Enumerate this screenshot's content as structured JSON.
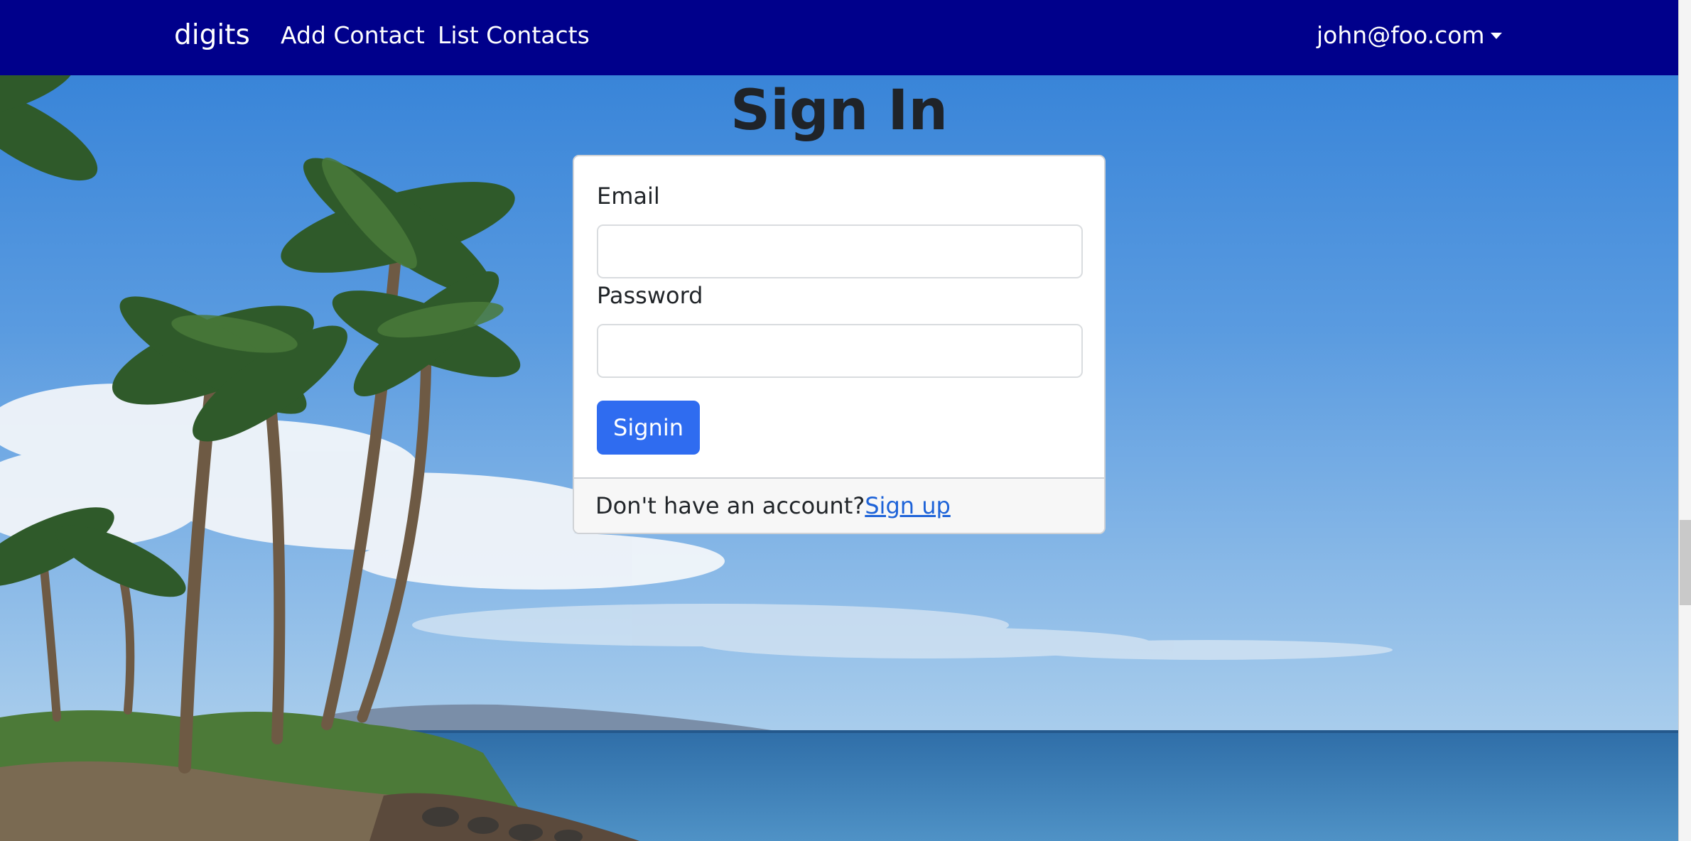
{
  "navbar": {
    "brand": "digits",
    "links": [
      {
        "label": "Add Contact"
      },
      {
        "label": "List Contacts"
      }
    ],
    "user": "john@foo.com",
    "background_color": "#00008b"
  },
  "signin": {
    "title": "Sign In",
    "email_label": "Email",
    "email_value": "",
    "password_label": "Password",
    "password_value": "",
    "submit_label": "Signin",
    "footer_text": "Don't have an account?",
    "signup_link": "Sign up",
    "button_color": "#2f6cf0",
    "link_color": "#1e63d8"
  }
}
